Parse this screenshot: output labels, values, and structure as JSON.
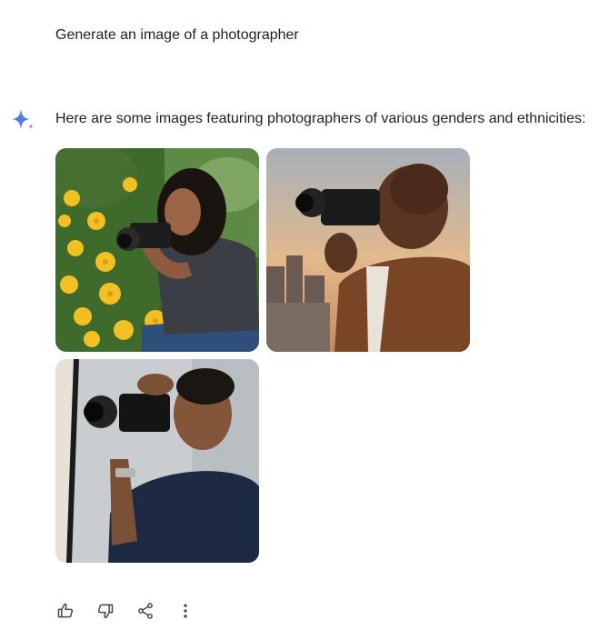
{
  "conversation": {
    "user_prompt": "Generate an image of a photographer",
    "assistant_icon": "gemini-sparkle-icon",
    "response_text": "Here are some images featuring photographers of various genders and ethnicities:",
    "images": [
      {
        "name": "photographer-image-1"
      },
      {
        "name": "photographer-image-2"
      },
      {
        "name": "photographer-image-3"
      }
    ]
  },
  "actions": [
    {
      "icon": "thumbs-up-icon"
    },
    {
      "icon": "thumbs-down-icon"
    },
    {
      "icon": "share-icon"
    },
    {
      "icon": "more-vert-icon"
    }
  ],
  "colors": {
    "sparkle": "#4f7fe3",
    "text": "#1f1f1f",
    "icon": "#444746"
  }
}
